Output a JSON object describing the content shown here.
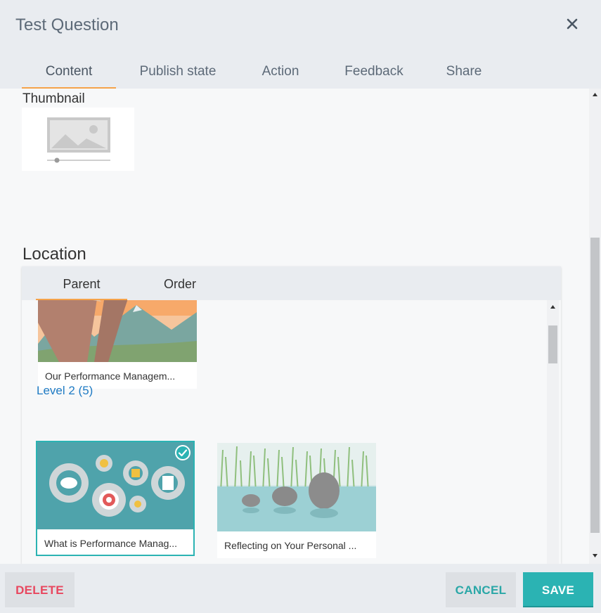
{
  "dialog": {
    "title": "Test Question",
    "close_icon": "close-icon"
  },
  "tabs": [
    {
      "label": "Content",
      "active": true
    },
    {
      "label": "Publish state",
      "active": false
    },
    {
      "label": "Action",
      "active": false
    },
    {
      "label": "Feedback",
      "active": false
    },
    {
      "label": "Share",
      "active": false
    }
  ],
  "thumbnail": {
    "label": "Thumbnail",
    "icon": "image-placeholder-icon"
  },
  "location": {
    "label": "Location",
    "tabs": [
      {
        "label": "Parent",
        "active": true
      },
      {
        "label": "Order",
        "active": false
      }
    ],
    "cards_top": [
      {
        "caption": "Our Performance Managem..."
      }
    ],
    "level": {
      "label": "Level 2 (5)"
    },
    "cards_level2": [
      {
        "caption": "What is Performance Manag...",
        "selected": true
      },
      {
        "caption": "Reflecting on Your Personal ...",
        "selected": false
      }
    ]
  },
  "footer": {
    "delete_label": "DELETE",
    "cancel_label": "CANCEL",
    "save_label": "SAVE"
  },
  "colors": {
    "accent": "#2bb3b3",
    "tab_underline": "#f5a34a",
    "delete": "#e8475f",
    "level_link": "#1f7bc4"
  }
}
